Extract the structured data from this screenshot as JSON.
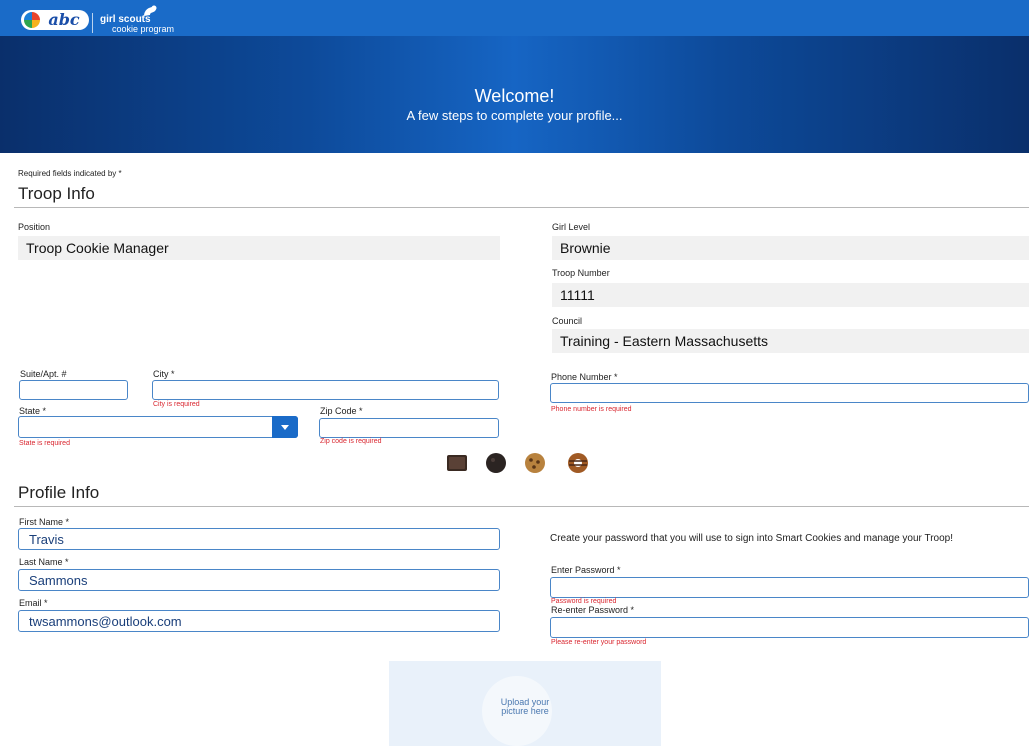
{
  "header": {
    "logo_text": "abc",
    "brand_name": "girl scouts",
    "brand_sub": "cookie program"
  },
  "hero": {
    "title": "Welcome!",
    "subtitle": "A few steps to complete your profile..."
  },
  "required_note": "Required fields indicated by *",
  "troop_info": {
    "title": "Troop Info",
    "position_label": "Position",
    "position_value": "Troop Cookie Manager",
    "girl_level_label": "Girl Level",
    "girl_level_value": "Brownie",
    "troop_number_label": "Troop Number",
    "troop_number_value": "11111",
    "council_label": "Council",
    "council_value": "Training - Eastern Massachusetts"
  },
  "address": {
    "suite_label": "Suite/Apt. #",
    "suite_value": "",
    "city_label": "City *",
    "city_value": "",
    "city_error": "City is required",
    "state_label": "State *",
    "state_value": "",
    "state_error": "State is required",
    "zip_label": "Zip Code *",
    "zip_value": "",
    "zip_error": "Zip code is required",
    "phone_label": "Phone Number *",
    "phone_value": "",
    "phone_error": "Phone number is required"
  },
  "cookie_icons": [
    "brownie-cookie-icon",
    "chocolate-cookie-icon",
    "chip-cookie-icon",
    "caramel-ring-cookie-icon"
  ],
  "profile_info": {
    "title": "Profile Info",
    "first_name_label": "First Name *",
    "first_name_value": "Travis",
    "last_name_label": "Last Name *",
    "last_name_value": "Sammons",
    "email_label": "Email *",
    "email_value": "twsammons@outlook.com",
    "password_helper": "Create your password that you will use to sign into Smart Cookies and manage your Troop!",
    "password_label": "Enter Password *",
    "password_value": "",
    "password_error": "Password is required",
    "reenter_label": "Re-enter Password *",
    "reenter_value": "",
    "reenter_error": "Please re-enter your password"
  },
  "upload": {
    "text_line1": "Upload your",
    "text_line2": "picture here"
  },
  "colors": {
    "brand_blue": "#1a6bc8",
    "hero_dark": "#0a2f6b",
    "input_border": "#4a86c8",
    "error_red": "#d9262f",
    "readonly_bg": "#f1f1f1"
  }
}
